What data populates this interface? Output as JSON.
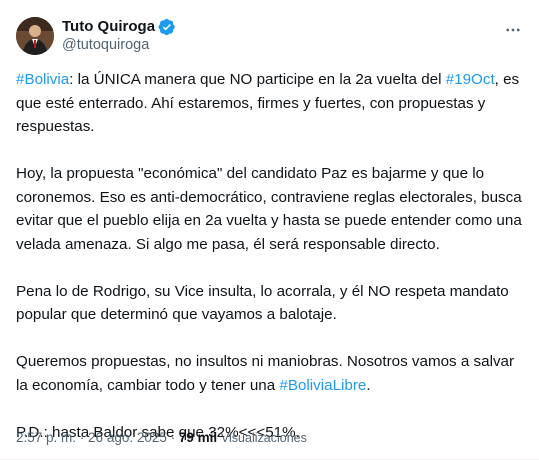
{
  "author": {
    "display_name": "Tuto Quiroga",
    "handle": "@tutoquiroga",
    "verified_color": "#1d9bf0"
  },
  "tweet": {
    "p1": {
      "hashtag1": "#Bolivia",
      "text1": ": la ÚNICA manera que NO participe en la 2a vuelta del ",
      "hashtag2": "#19Oct",
      "text2": ", es que esté enterrado. Ahí estaremos, firmes y fuertes, con propuestas y respuestas."
    },
    "p2": "Hoy, la propuesta \"económica\" del candidato Paz es bajarme y que lo coronemos. Eso es anti-democrático, contraviene reglas electorales, busca evitar que el pueblo elija en 2a vuelta y hasta se puede entender como una velada amenaza. Si algo me pasa, él será responsable directo.",
    "p3": "Pena lo de Rodrigo, su Vice insulta, lo acorrala, y él NO respeta mandato popular que determinó que vayamos a balotaje.",
    "p4": {
      "text1": "Queremos propuestas, no insultos ni maniobras. Nosotros vamos a salvar la economía, cambiar todo y tener una ",
      "hashtag": "#BoliviaLibre",
      "text2": "."
    },
    "p5": "P.D.: hasta Baldor sabe que 32%<<<51%."
  },
  "meta": {
    "time": "2:57 p. m.",
    "separator1": " · ",
    "date": "26 ago. 2025",
    "separator2": " · ",
    "views_count": "79 mil",
    "views_label": "Visualizaciones"
  },
  "colors": {
    "link": "#1d9bf0",
    "text": "#0f1419",
    "secondary": "#536471"
  },
  "icons": {
    "verified": "verified-badge-icon",
    "more": "more-options-icon"
  }
}
